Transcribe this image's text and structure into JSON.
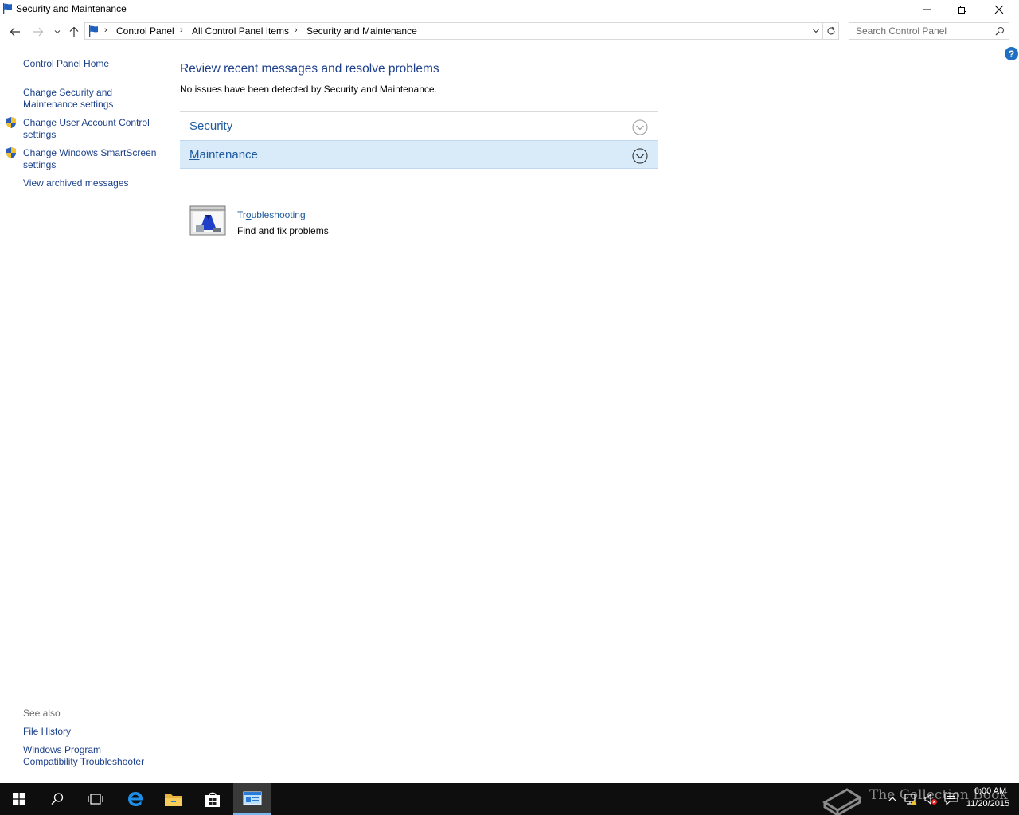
{
  "window": {
    "title": "Security and Maintenance",
    "controls": {
      "minimize": "minimize",
      "maximize": "restore",
      "close": "close"
    }
  },
  "nav": {
    "breadcrumbs": [
      "Control Panel",
      "All Control Panel Items",
      "Security and Maintenance"
    ],
    "search_placeholder": "Search Control Panel"
  },
  "left_pane": {
    "home": "Control Panel Home",
    "links": [
      {
        "label": "Change Security and Maintenance settings",
        "shield": false
      },
      {
        "label": "Change User Account Control settings",
        "shield": true
      },
      {
        "label": "Change Windows SmartScreen settings",
        "shield": true
      },
      {
        "label": "View archived messages",
        "shield": false
      }
    ],
    "see_also": {
      "heading": "See also",
      "links": [
        "File History",
        "Windows Program Compatibility Troubleshooter"
      ]
    }
  },
  "main": {
    "heading": "Review recent messages and resolve problems",
    "status": "No issues have been detected by Security and Maintenance.",
    "sections": [
      {
        "first_letter": "S",
        "rest": "ecurity",
        "expanded": false
      },
      {
        "first_letter": "M",
        "rest": "aintenance",
        "expanded": false,
        "highlighted": true
      }
    ],
    "troubleshooting": {
      "title_pre": "Tr",
      "title_ul": "o",
      "title_post": "ubleshooting",
      "description": "Find and fix problems"
    }
  },
  "taskbar": {
    "watermark": "The Collection Book",
    "time": "6:00 AM",
    "date": "11/20/2015",
    "colors": {
      "background": "#0e0e0e",
      "active": "#3a3a3a",
      "accent": "#7ab8f2"
    }
  },
  "colors": {
    "link": "#1a3f8a",
    "heading": "#1e3f8c",
    "section_highlight": "#d9ebf9",
    "help": "#1f6fc2"
  }
}
